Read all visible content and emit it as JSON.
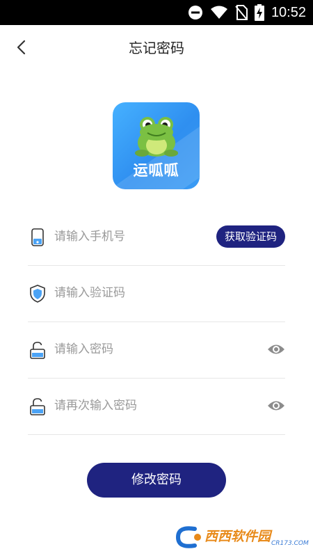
{
  "status_bar": {
    "time": "10:52"
  },
  "header": {
    "title": "忘记密码"
  },
  "logo": {
    "text": "运呱呱"
  },
  "form": {
    "phone": {
      "placeholder": "请输入手机号",
      "get_code_label": "获取验证码"
    },
    "code": {
      "placeholder": "请输入验证码"
    },
    "password": {
      "placeholder": "请输入密码"
    },
    "confirm": {
      "placeholder": "请再次输入密码"
    }
  },
  "submit_label": "修改密码",
  "watermark": {
    "text": "西西软件园",
    "sub": "CR173.COM"
  },
  "colors": {
    "primary": "#1f2380",
    "logo_blue": "#3a9bf4"
  }
}
